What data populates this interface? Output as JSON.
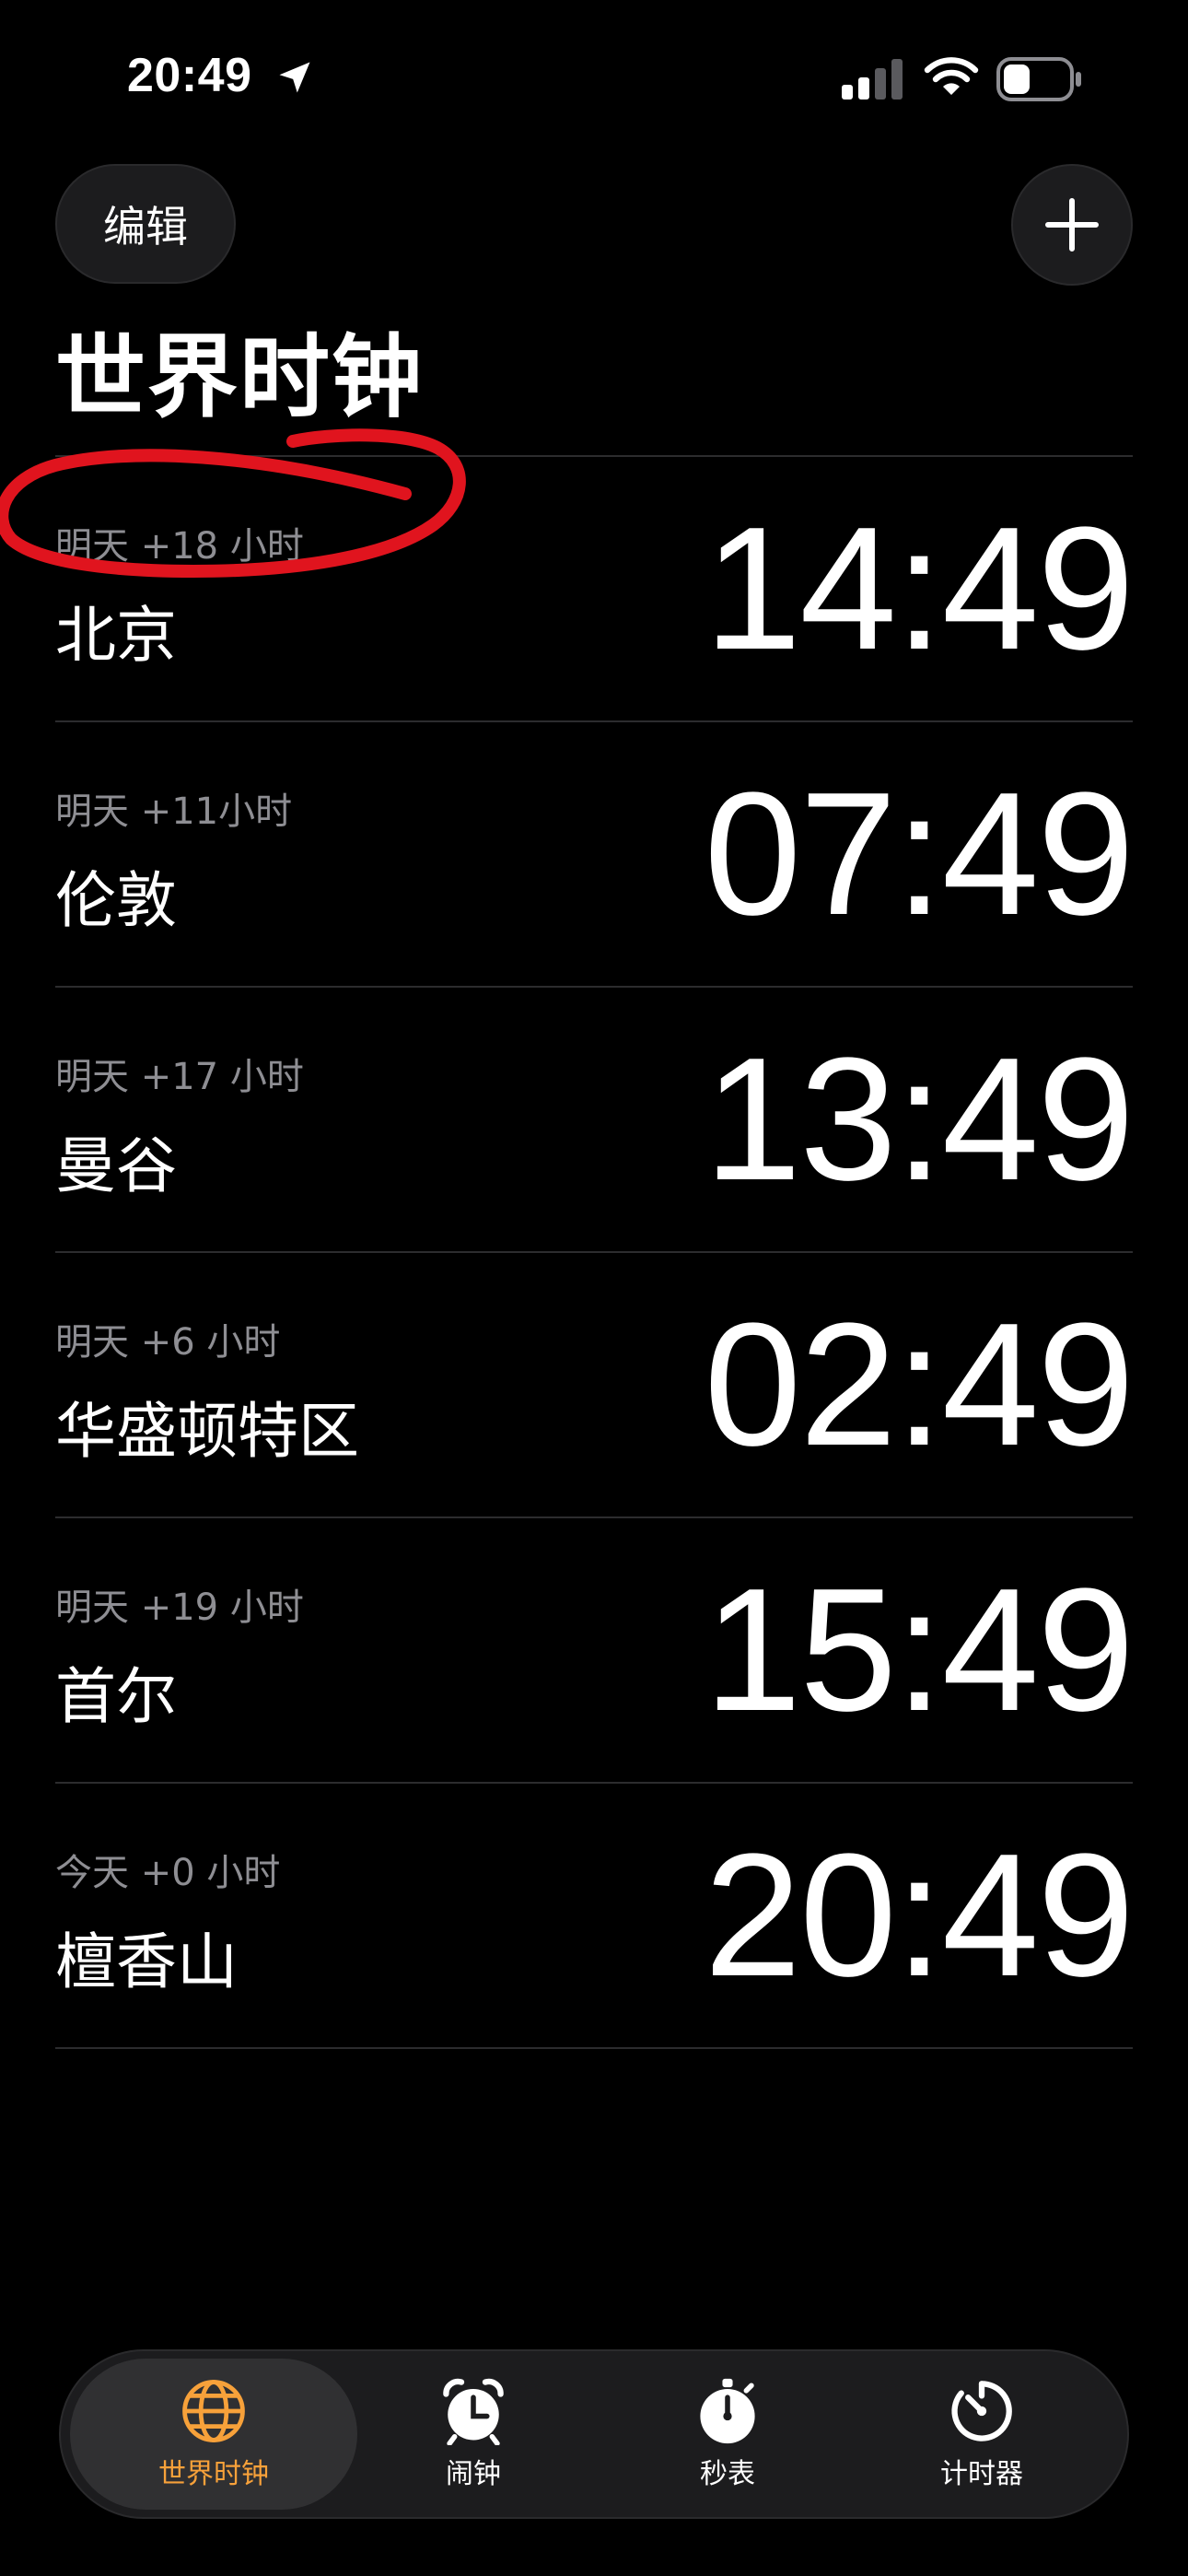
{
  "status_bar": {
    "time": "20:49"
  },
  "header": {
    "edit_label": "编辑"
  },
  "title": "世界时钟",
  "clocks": [
    {
      "offset": "明天 +18 小时",
      "city": "北京",
      "time": "14:49"
    },
    {
      "offset": "明天 +11小时",
      "city": "伦敦",
      "time": "07:49"
    },
    {
      "offset": "明天 +17 小时",
      "city": "曼谷",
      "time": "13:49"
    },
    {
      "offset": "明天 +6 小时",
      "city": "华盛顿特区",
      "time": "02:49"
    },
    {
      "offset": "明天 +19 小时",
      "city": "首尔",
      "time": "15:49"
    },
    {
      "offset": "今天 +0 小时",
      "city": "檀香山",
      "time": "20:49"
    }
  ],
  "tabs": [
    {
      "label": "世界时钟",
      "icon": "globe-icon",
      "active": true
    },
    {
      "label": "闹钟",
      "icon": "alarm-clock-icon",
      "active": false
    },
    {
      "label": "秒表",
      "icon": "stopwatch-icon",
      "active": false
    },
    {
      "label": "计时器",
      "icon": "timer-icon",
      "active": false
    }
  ],
  "colors": {
    "accent": "#f7a13a",
    "annotation": "#e0141e",
    "background": "#000000"
  }
}
